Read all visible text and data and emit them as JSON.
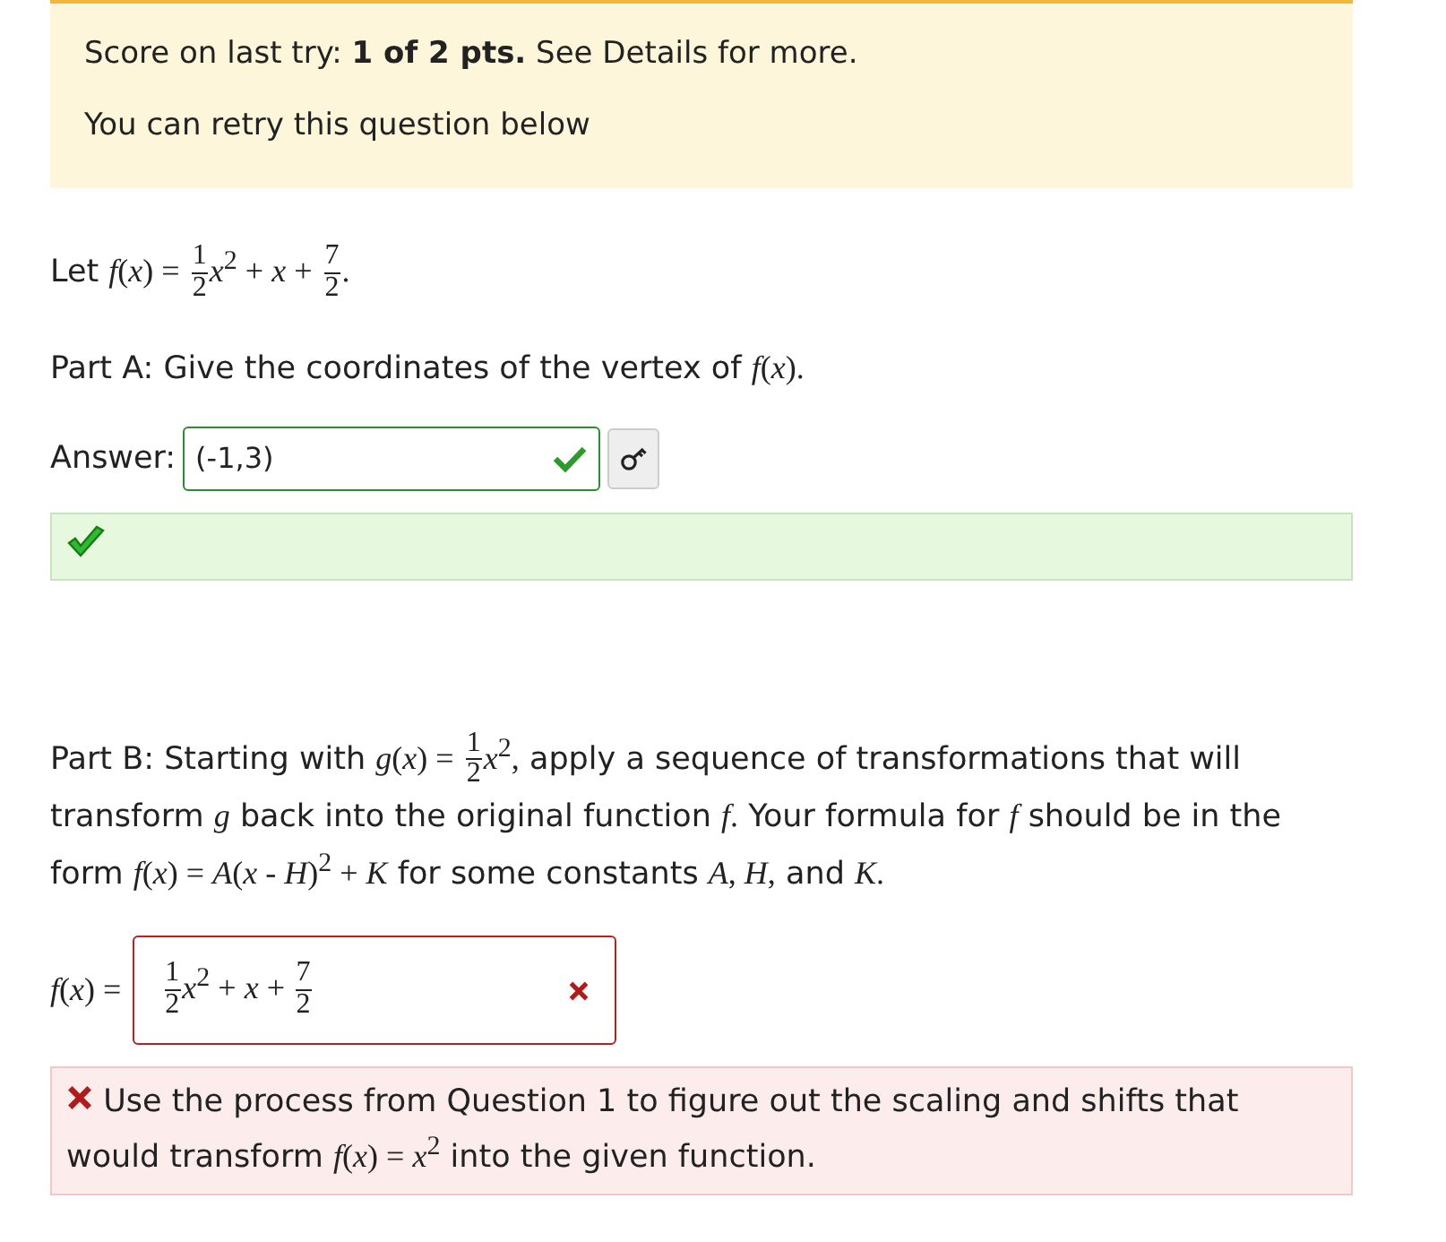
{
  "score_banner": {
    "score_line": "Score on last try: **1 of 2 pts.** See Details for more.",
    "retry_line": "You can retry this question below"
  },
  "statement": [
    {
      "kind": "text",
      "text": "Let"
    },
    {
      "kind": "math",
      "text": "*f*(*x*) ="
    },
    {
      "kind": "frac",
      "num": "1",
      "den": "2"
    },
    {
      "kind": "math",
      "text": "*x*$^{2}$ + *x* +"
    },
    {
      "kind": "frac",
      "num": "7",
      "den": "2"
    },
    {
      "kind": "math",
      "text": "."
    }
  ],
  "part_a": {
    "prompt": [
      {
        "kind": "text",
        "text": "Part A: Give the coordinates of the vertex of"
      },
      {
        "kind": "math",
        "text": "*f*(*x*)."
      }
    ],
    "label": "Answer:",
    "answer": {
      "value": "(-1,3)",
      "correct": true
    },
    "feedback": {
      "correct": true
    }
  },
  "part_b": {
    "prompt": [
      {
        "kind": "text",
        "text": "Part B: Starting with"
      },
      {
        "kind": "math",
        "text": "*g*(*x*) ="
      },
      {
        "kind": "frac",
        "num": "1",
        "den": "2"
      },
      {
        "kind": "math",
        "text": "*x*$^{2}$,"
      },
      {
        "kind": "text",
        "text": "apply a sequence of transformations that will transform"
      },
      {
        "kind": "math",
        "text": "*g*"
      },
      {
        "kind": "text",
        "text": "back into the original function"
      },
      {
        "kind": "math",
        "text": "*f*."
      },
      {
        "kind": "text",
        "text": "Your formula for"
      },
      {
        "kind": "math",
        "text": "*f*"
      },
      {
        "kind": "text",
        "text": "should be in the form"
      },
      {
        "kind": "math",
        "text": "*f*(*x*) = *A*(*x* - *H*)$^{2}$ + *K*"
      },
      {
        "kind": "text",
        "text": "for some constants"
      },
      {
        "kind": "math",
        "text": "*A*, *H*,"
      },
      {
        "kind": "text",
        "text": "and"
      },
      {
        "kind": "math",
        "text": "*K*."
      }
    ],
    "label": [
      {
        "kind": "math",
        "text": "*f*(*x*) ="
      }
    ],
    "answer": {
      "value": [
        {
          "kind": "frac",
          "num": "1",
          "den": "2"
        },
        {
          "kind": "math",
          "text": "*x*$^{2}$ + *x* +"
        },
        {
          "kind": "frac",
          "num": "7",
          "den": "2"
        }
      ],
      "correct": false
    },
    "feedback": {
      "correct": false,
      "message": [
        {
          "kind": "text",
          "text": "Use the process from Question 1 to figure out the scaling and shifts that would transform"
        },
        {
          "kind": "math",
          "text": "*f*(*x*) = *x*$^{2}$"
        },
        {
          "kind": "text",
          "text": "into the given function."
        }
      ]
    }
  }
}
